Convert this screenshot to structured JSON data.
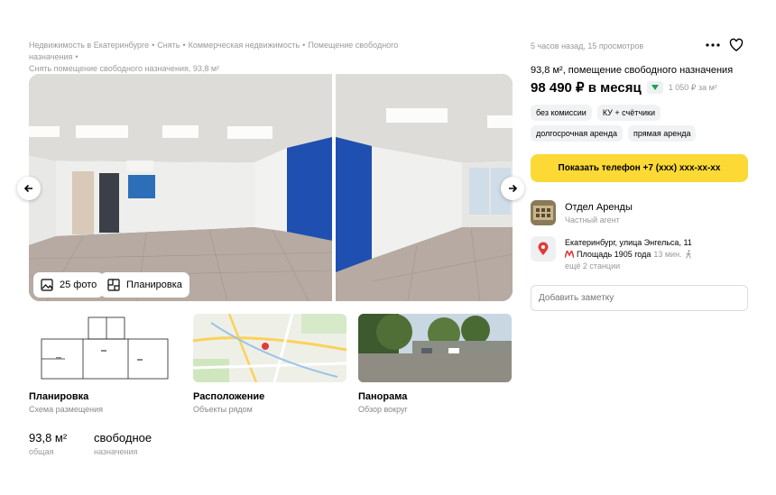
{
  "breadcrumbs": {
    "items": [
      "Недвижимость в Екатеринбурге",
      "Снять",
      "Коммерческая недвижимость",
      "Помещение свободного назначения"
    ],
    "current": "Снять помещение свободного назначения, 93,8 м²"
  },
  "gallery": {
    "photos_button": "25 фото",
    "plan_button": "Планировка"
  },
  "cards": [
    {
      "title": "Планировка",
      "sub": "Схема размещения"
    },
    {
      "title": "Расположение",
      "sub": "Объекты рядом"
    },
    {
      "title": "Панорама",
      "sub": "Обзор вокруг"
    }
  ],
  "params": [
    {
      "value": "93,8 м²",
      "label": "общая"
    },
    {
      "value": "свободное",
      "label": "назначения"
    }
  ],
  "offer": {
    "meta": "5 часов назад, 15 просмотров",
    "title": "93,8 м², помещение свободного назначения",
    "price": "98 490 ₽ в месяц",
    "price_per": "1 050 ₽ за м²",
    "tags": [
      "без комиссии",
      "КУ + счётчики",
      "долгосрочная аренда",
      "прямая аренда"
    ],
    "phone_button": "Показать телефон +7 (ххх) ххх-хх-хх"
  },
  "agent": {
    "name": "Отдел Аренды",
    "role": "Частный агент"
  },
  "address": {
    "street": "Екатеринбург, улица Энгельса, 11",
    "metro": "Площадь 1905 года",
    "walk": "13 мин.",
    "more": "ещё 2 станции"
  },
  "note": {
    "placeholder": "Добавить заметку"
  },
  "colors": {
    "accent": "#fcd934",
    "metro": "#e23b3b",
    "trend": "#19a54a"
  }
}
